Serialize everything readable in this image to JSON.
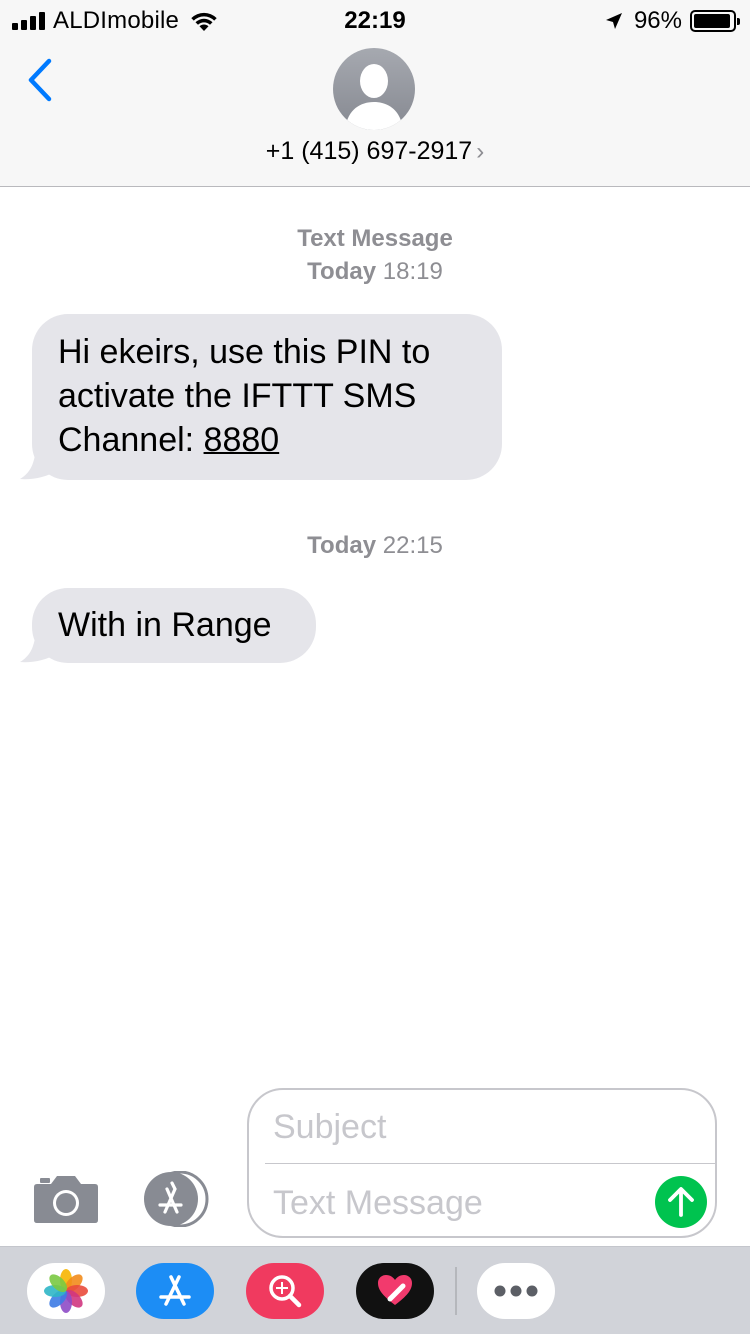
{
  "status_bar": {
    "carrier": "ALDImobile",
    "time": "22:19",
    "battery_percent": "96%",
    "battery_level": 0.96
  },
  "header": {
    "contact": "+1 (415) 697-2917",
    "chevron": "›"
  },
  "conversation": {
    "thread_label": "Text Message",
    "groups": [
      {
        "day": "Today",
        "time": "18:19",
        "message_lines": [
          "Hi ekeirs, use this PIN to",
          "activate the IFTTT SMS",
          "Channel: "
        ],
        "pin": "8880"
      },
      {
        "day": "Today",
        "time": "22:15",
        "message": "With in Range"
      }
    ]
  },
  "compose": {
    "subject_placeholder": "Subject",
    "message_placeholder": "Text Message"
  },
  "app_drawer": {
    "apps": [
      "photos-app-icon",
      "app-store-icon",
      "search-images-icon",
      "digital-touch-icon",
      "more-icon"
    ]
  },
  "colors": {
    "accent": "#007aff",
    "bubble_received": "#e5e5ea",
    "send_button": "#00c34f",
    "timestamp": "#8e8e93"
  }
}
